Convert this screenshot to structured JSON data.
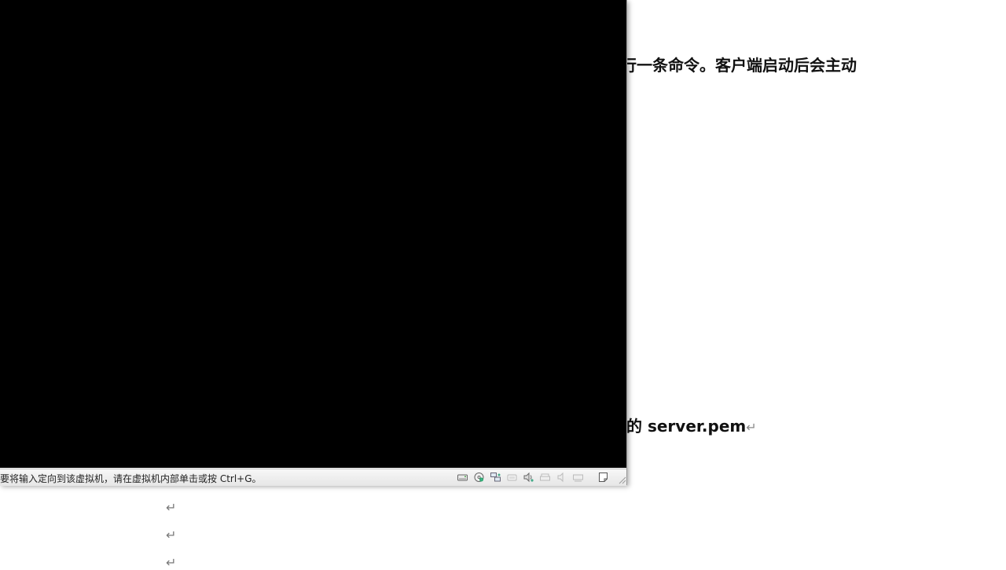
{
  "document": {
    "line1": "行一条命令。客户端启动后会主动",
    "line2_prefix": "的 server.pem",
    "paragraph_mark": "↵"
  },
  "vm_window": {
    "status_text": "要将输入定向到该虚拟机，请在虚拟机内部单击或按 Ctrl+G。",
    "status_icons": [
      "hard-disk-icon",
      "cd-dvd-icon",
      "network-adapter-icon",
      "usb-icon",
      "sound-card-icon",
      "printer-icon",
      "speaker-icon",
      "display-icon",
      "message-icon"
    ]
  }
}
